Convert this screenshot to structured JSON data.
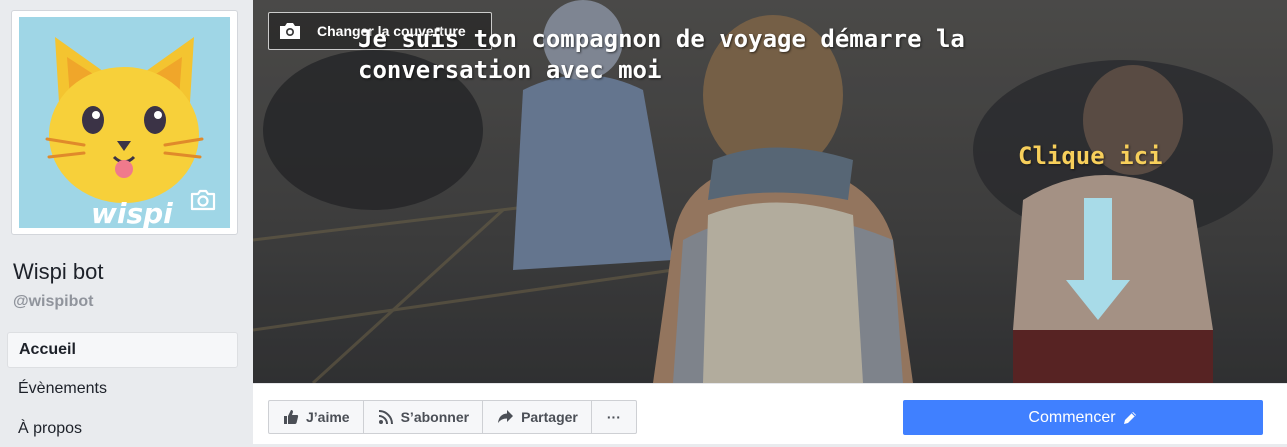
{
  "page": {
    "name": "Wispi bot",
    "handle": "@wispibot",
    "avatar_text": "wispi"
  },
  "nav": {
    "items": [
      {
        "label": "Accueil",
        "active": true
      },
      {
        "label": "Évènements",
        "active": false
      },
      {
        "label": "À propos",
        "active": false
      }
    ]
  },
  "cover": {
    "change_label": "Changer la couverture",
    "overlay_line1": "Je suis ton compagnon de voyage démarre la",
    "overlay_line2": "conversation avec moi",
    "cta_text": "Clique ici"
  },
  "actions": {
    "like": "J’aime",
    "subscribe": "S’abonner",
    "share": "Partager",
    "more": "···",
    "primary": "Commencer"
  },
  "colors": {
    "primary": "#4080ff",
    "cta_yellow": "#f7cf5b",
    "arrow": "#a8dbe8",
    "avatar_bg": "#9fd6e6"
  },
  "icons": [
    "camera-icon",
    "thumbs-up-icon",
    "rss-icon",
    "share-arrow-icon",
    "pencil-icon",
    "down-arrow-icon"
  ]
}
